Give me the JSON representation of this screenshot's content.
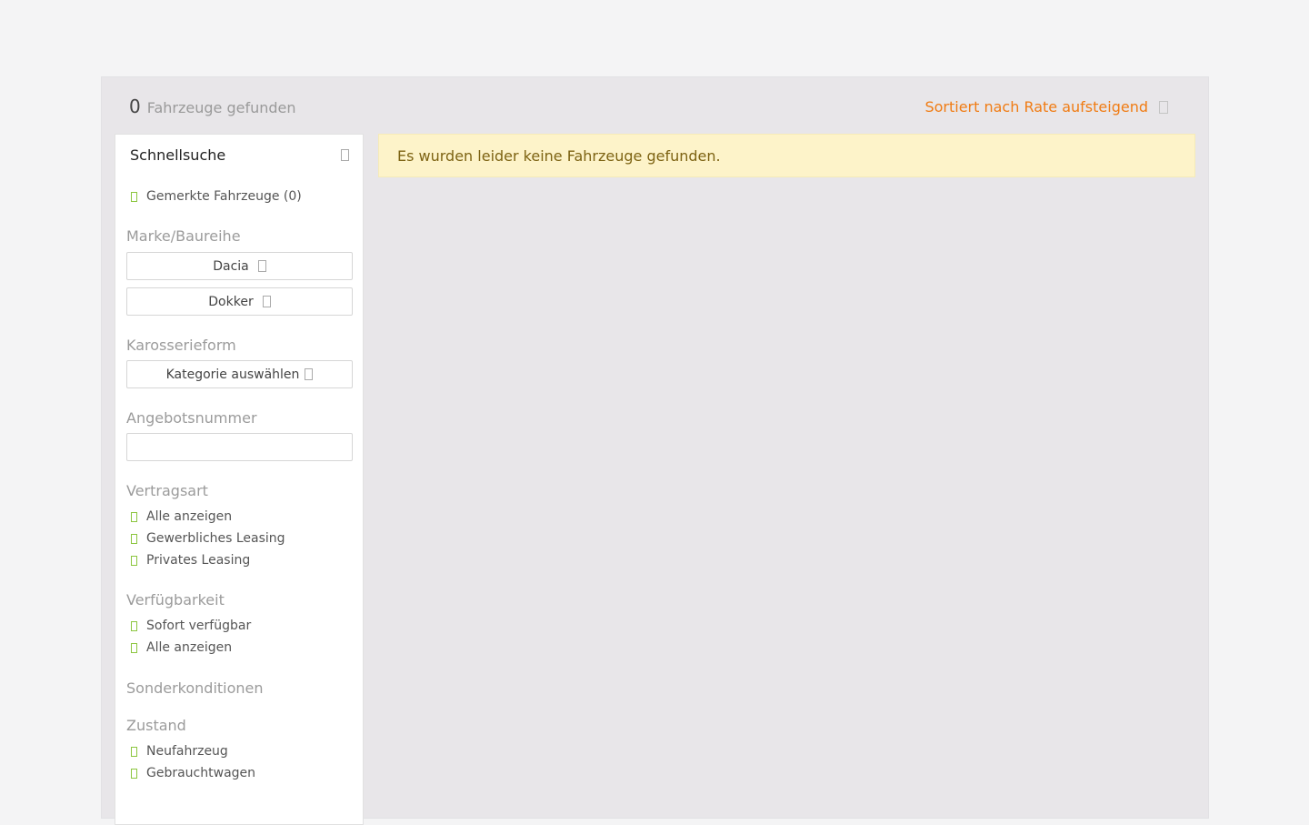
{
  "results": {
    "count": "0",
    "count_label": "Fahrzeuge gefunden",
    "sort_label": "Sortiert nach Rate aufsteigend"
  },
  "alert": {
    "message": "Es wurden leider keine Fahrzeuge gefunden."
  },
  "sidebar": {
    "title": "Schnellsuche",
    "saved_vehicles": "Gemerkte Fahrzeuge (0)",
    "brand_section": {
      "title": "Marke/Baureihe",
      "brand": "Dacia",
      "model": "Dokker"
    },
    "body_section": {
      "title": "Karosserieform",
      "category_button": "Kategorie auswählen"
    },
    "offer_section": {
      "title": "Angebotsnummer",
      "placeholder": ""
    },
    "contract_section": {
      "title": "Vertragsart",
      "options": [
        "Alle anzeigen",
        "Gewerbliches Leasing",
        "Privates Leasing"
      ]
    },
    "availability_section": {
      "title": "Verfügbarkeit",
      "options": [
        "Sofort verfügbar",
        "Alle anzeigen"
      ]
    },
    "special_section": {
      "title": "Sonderkonditionen"
    },
    "condition_section": {
      "title": "Zustand",
      "options": [
        "Neufahrzeug",
        "Gebrauchtwagen"
      ]
    }
  },
  "colors": {
    "accent_orange": "#f07c14",
    "check_green": "#8cc63f",
    "alert_bg": "#fdf3c9",
    "alert_text": "#7d6313"
  }
}
